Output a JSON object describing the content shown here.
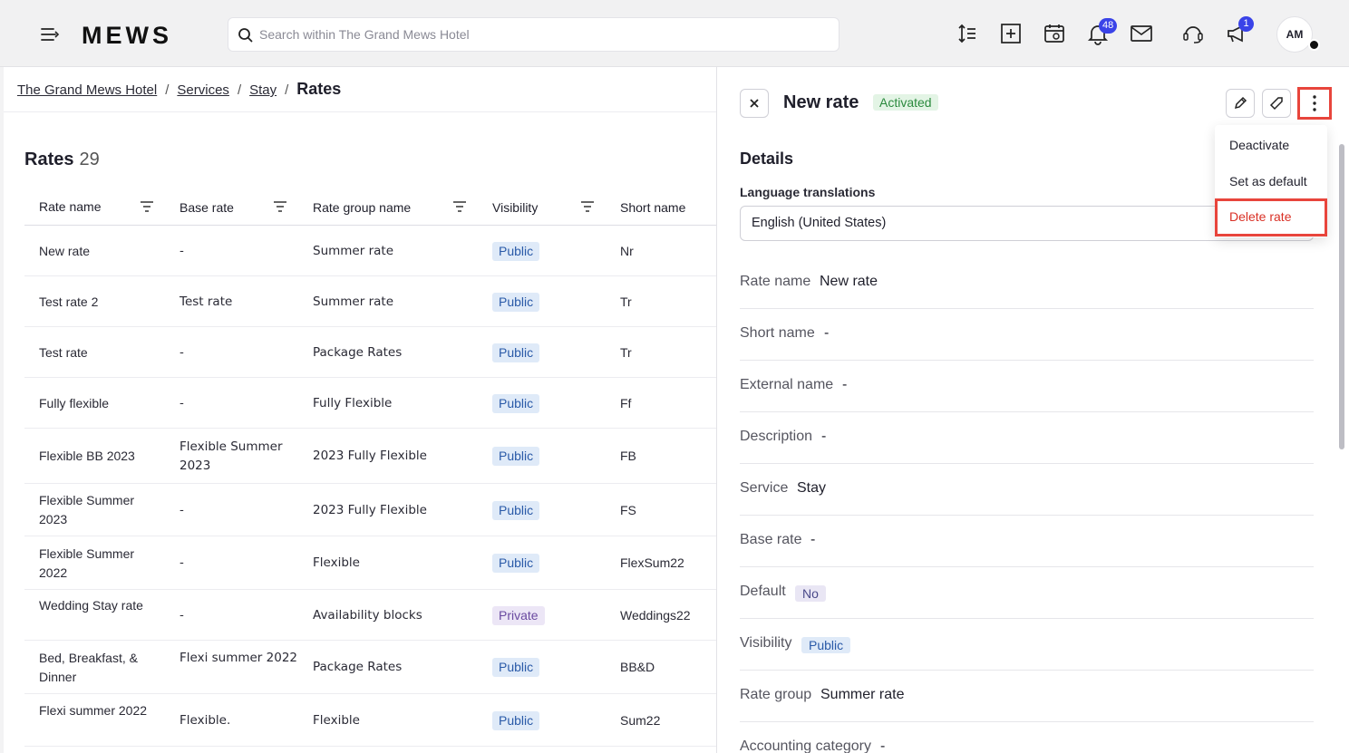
{
  "header": {
    "logo": "MEWS",
    "search_placeholder": "Search within The Grand Mews Hotel",
    "notifications_count": "48",
    "announcements_count": "1",
    "avatar_initials": "AM"
  },
  "breadcrumb": {
    "items": [
      "The Grand Mews Hotel",
      "Services",
      "Stay"
    ],
    "current": "Rates"
  },
  "rates": {
    "title": "Rates",
    "count": "29",
    "columns": [
      "Rate name",
      "Base rate",
      "Rate group name",
      "Visibility",
      "Short name"
    ],
    "rows": [
      {
        "name": "New rate",
        "base": "-",
        "group": "Summer rate",
        "visibility": "Public",
        "short": "Nr"
      },
      {
        "name": "Test rate 2",
        "base": "Test rate",
        "group": "Summer rate",
        "visibility": "Public",
        "short": "Tr"
      },
      {
        "name": "Test rate",
        "base": "-",
        "group": "Package Rates",
        "visibility": "Public",
        "short": "Tr"
      },
      {
        "name": "Fully flexible",
        "base": "-",
        "group": "Fully Flexible",
        "visibility": "Public",
        "short": "Ff"
      },
      {
        "name": "Flexible BB 2023",
        "base": "Flexible Summer 2023",
        "group": "2023 Fully Flexible",
        "visibility": "Public",
        "short": "FB"
      },
      {
        "name": "Flexible Summer 2023",
        "base": "-",
        "group": "2023 Fully Flexible",
        "visibility": "Public",
        "short": "FS"
      },
      {
        "name": "Flexible Summer 2022",
        "base": "-",
        "group": "Flexible",
        "visibility": "Public",
        "short": "FlexSum22"
      },
      {
        "name": "Wedding Stay rate",
        "base": "-",
        "group": "Availability blocks",
        "visibility": "Private",
        "short": "Weddings22"
      },
      {
        "name": "Bed, Breakfast, & Dinner",
        "base": "Flexi summer 2022",
        "group": "Package Rates",
        "visibility": "Public",
        "short": "BB&D"
      },
      {
        "name": "Flexi summer 2022",
        "base": "Flexible.",
        "group": "Flexible",
        "visibility": "Public",
        "short": "Sum22"
      }
    ]
  },
  "detail": {
    "title": "New rate",
    "status": "Activated",
    "section": "Details",
    "language_label": "Language translations",
    "language_value": "English (United States)",
    "fields": [
      {
        "label": "Rate name",
        "value": "New rate"
      },
      {
        "label": "Short name",
        "value": "-"
      },
      {
        "label": "External name",
        "value": "-"
      },
      {
        "label": "Description",
        "value": "-"
      },
      {
        "label": "Service",
        "value": "Stay"
      },
      {
        "label": "Base rate",
        "value": "-"
      },
      {
        "label": "Default",
        "value": "No"
      },
      {
        "label": "Visibility",
        "value": "Public"
      },
      {
        "label": "Rate group",
        "value": "Summer rate"
      },
      {
        "label": "Accounting category",
        "value": "-"
      }
    ]
  },
  "menu": {
    "items": [
      "Deactivate",
      "Set as default",
      "Delete rate"
    ]
  }
}
